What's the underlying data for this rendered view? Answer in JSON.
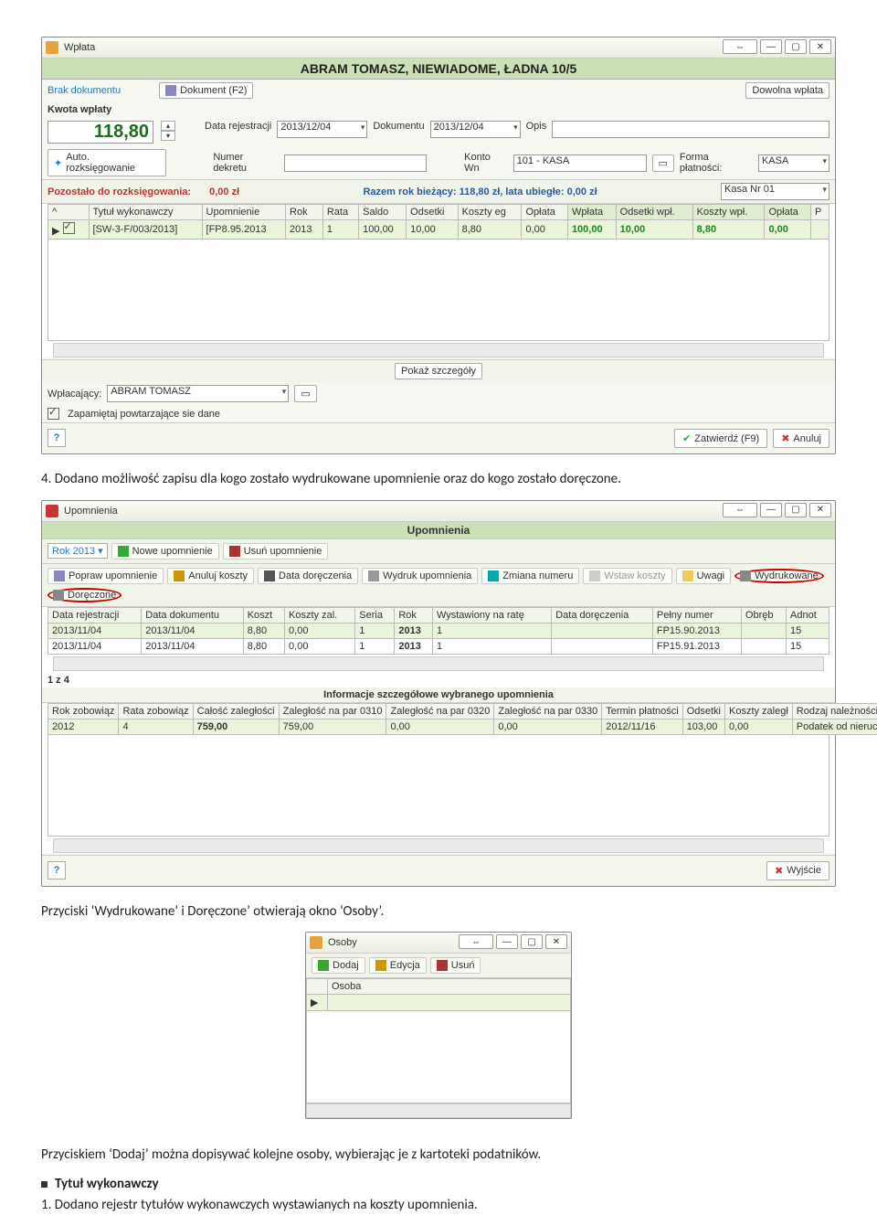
{
  "wplata": {
    "title": "Wpłata",
    "header": "ABRAM TOMASZ, NIEWIADOME, ŁADNA 10/5",
    "brak": "Brak dokumentu",
    "dokument_btn": "Dokument (F2)",
    "dowolna": "Dowolna wpłata",
    "kwota_lbl": "Kwota wpłaty",
    "amount": "118,80",
    "auto": "Auto. rozksięgowanie",
    "data_rej_lbl": "Data rejestracji",
    "data_rej": "2013/12/04",
    "dokumentu_lbl": "Dokumentu",
    "dokumentu": "2013/12/04",
    "opis_lbl": "Opis",
    "numer_lbl": "Numer dekretu",
    "konto_lbl": "Konto Wn",
    "konto": "101 - KASA",
    "forma_lbl": "Forma płatności:",
    "forma": "KASA",
    "pozostalo": "Pozostało do rozksięgowania:",
    "pozostalo_val": "0,00 zł",
    "razem": "Razem rok bieżący: 118,80 zł,   lata ubiegłe: 0,00 zł",
    "kasa": "Kasa Nr 01",
    "cols": [
      "^",
      "Tytuł wykonawczy",
      "Upomnienie",
      "Rok",
      "Rata",
      "Saldo",
      "Odsetki",
      "Koszty eg",
      "Opłata",
      "Wpłata",
      "Odsetki wpł.",
      "Koszty wpł.",
      "Opłata",
      "P"
    ],
    "rowvals": [
      "[SW-3-F/003/2013]",
      "[FP8.95.2013",
      "2013",
      "1",
      "100,00",
      "10,00",
      "8,80",
      "0,00",
      "100,00",
      "10,00",
      "8,80",
      "0,00"
    ],
    "pokaz": "Pokaż szczegóły",
    "wplacajacy_lbl": "Wpłacający:",
    "wplacajacy": "ABRAM TOMASZ",
    "zapam": "Zapamiętaj powtarzające sie dane",
    "zatwierdz": "Zatwierdź (F9)",
    "anuluj": "Anuluj"
  },
  "txt4": "4. Dodano możliwość zapisu dla kogo zostało wydrukowane upomnienie oraz do kogo zostało doręczone.",
  "upom": {
    "title": "Upomnienia",
    "header": "Upomnienia",
    "rok": "Rok 2013",
    "nowe": "Nowe upomnienie",
    "usun": "Usuń upomnienie",
    "t_popraw": "Popraw upomnienie",
    "t_anuluj": "Anuluj koszty",
    "t_data": "Data doręczenia",
    "t_wydruk": "Wydruk upomnienia",
    "t_zmiana": "Zmiana numeru",
    "t_wstaw": "Wstaw koszty",
    "t_uwagi": "Uwagi",
    "t_wydrukowane": "Wydrukowane",
    "t_doreczone": "Doręczone",
    "cols": [
      "Data rejestracji",
      "Data dokumentu",
      "Koszt",
      "Koszty zal.",
      "Seria",
      "Rok",
      "Wystawiony na ratę",
      "Data doręczenia",
      "Pełny numer",
      "Obręb",
      "Adnot"
    ],
    "row1": [
      "2013/11/04",
      "2013/11/04",
      "8,80",
      "0,00",
      "1",
      "2013",
      "1",
      "",
      "FP15.90.2013",
      "",
      "15"
    ],
    "row2": [
      "2013/11/04",
      "2013/11/04",
      "8,80",
      "0,00",
      "1",
      "2013",
      "1",
      "",
      "FP15.91.2013",
      "",
      "15"
    ],
    "pager": "1 z 4",
    "info_hdr": "Informacje szczegółowe wybranego upomnienia",
    "cols2": [
      "Rok zobowiąz",
      "Rata zobowiąz",
      "Całość zaległości",
      "Zaległość na par 0310",
      "Zaległość na par 0320",
      "Zaległość na par 0330",
      "Termin płatności",
      "Odsetki",
      "Koszty zaległ",
      "Rodzaj należności"
    ],
    "row3": [
      "2012",
      "4",
      "759,00",
      "759,00",
      "0,00",
      "0,00",
      "2012/11/16",
      "103,00",
      "0,00",
      "Podatek od nieruchomości"
    ],
    "wyjscie": "Wyjście"
  },
  "txt5": "Przyciski ‘Wydrukowane’ i Doręczone’ otwierają okno ‘Osoby’.",
  "osoby": {
    "title": "Osoby",
    "dodaj": "Dodaj",
    "edycja": "Edycja",
    "usun": "Usuń",
    "col": "Osoba"
  },
  "txt6": "Przyciskiem ‘Dodaj’ można dopisywać kolejne osoby, wybierając je z kartoteki podatników.",
  "bullet": "Tytuł wykonawczy",
  "txt7": "1. Dodano rejestr tytułów wykonawczych wystawianych na koszty upomnienia."
}
